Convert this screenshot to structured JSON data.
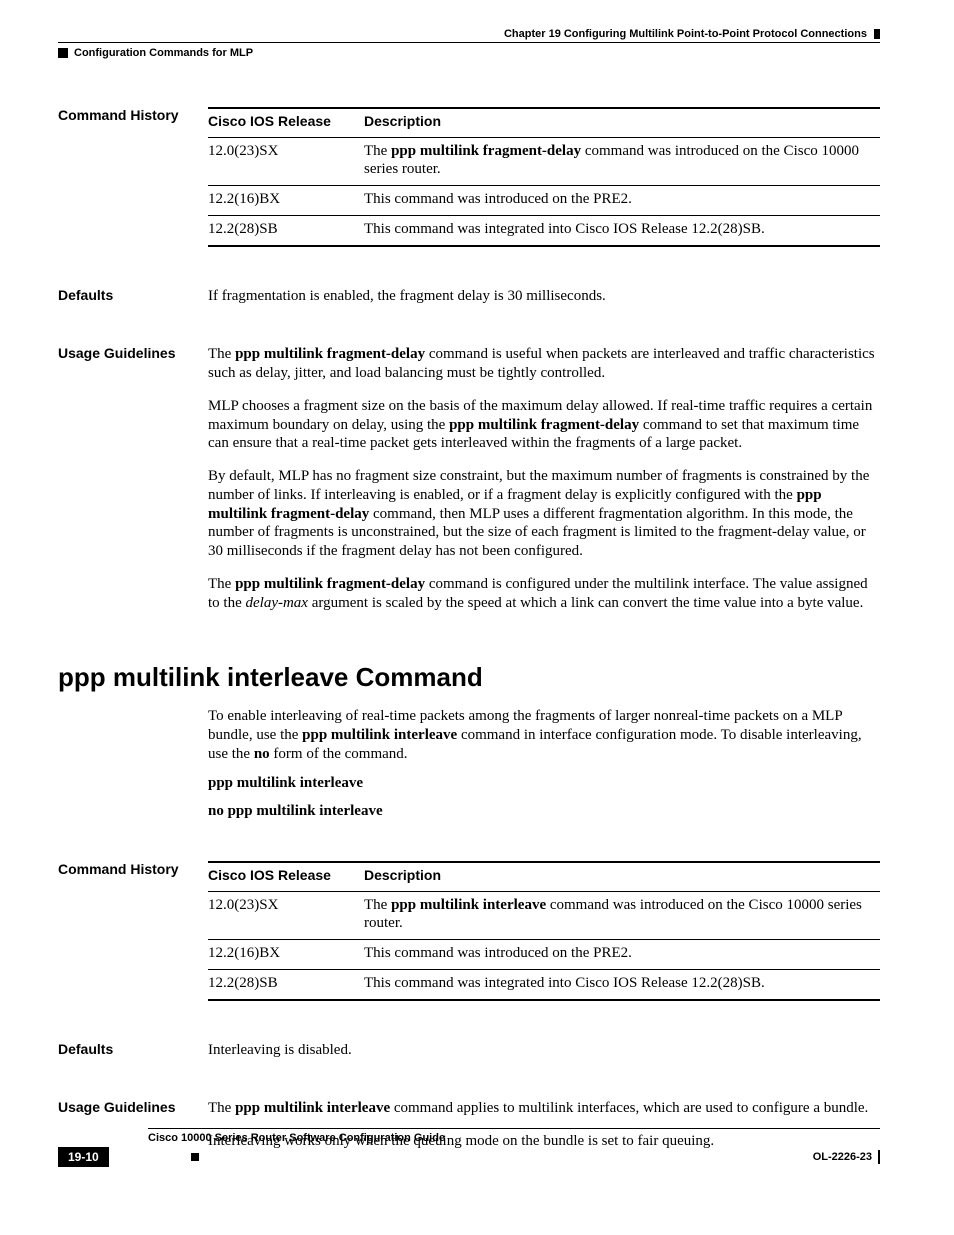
{
  "header": {
    "chapter": "Chapter 19      Configuring Multilink Point-to-Point Protocol Connections",
    "section": "Configuration Commands for MLP"
  },
  "history1": {
    "label": "Command History",
    "cols": {
      "c1": "Cisco IOS Release",
      "c2": "Description"
    },
    "rows": [
      {
        "rel": "12.0(23)SX",
        "desc_pre": "The ",
        "desc_bold": "ppp multilink fragment-delay",
        "desc_post": " command was introduced on the Cisco 10000 series router."
      },
      {
        "rel": "12.2(16)BX",
        "desc_pre": "This command was introduced on the PRE2.",
        "desc_bold": "",
        "desc_post": ""
      },
      {
        "rel": "12.2(28)SB",
        "desc_pre": "This command was integrated into Cisco IOS Release 12.2(28)SB.",
        "desc_bold": "",
        "desc_post": ""
      }
    ]
  },
  "defaults1": {
    "label": "Defaults",
    "text": "If fragmentation is enabled, the fragment delay is 30 milliseconds."
  },
  "usage1": {
    "label": "Usage Guidelines",
    "p1": {
      "a": "The ",
      "b": "ppp multilink fragment-delay",
      "c": " command is useful when packets are interleaved and traffic characteristics such as delay, jitter, and load balancing must be tightly controlled."
    },
    "p2": {
      "a": "MLP chooses a fragment size on the basis of the maximum delay allowed. If real-time traffic requires a certain maximum boundary on delay, using the ",
      "b": "ppp multilink fragment-delay",
      "c": " command to set that maximum time can ensure that a real-time packet gets interleaved within the fragments of a large packet."
    },
    "p3": {
      "a": "By default, MLP has no fragment size constraint, but the maximum number of fragments is constrained by the number of links. If interleaving is enabled, or if a fragment delay is explicitly configured with the ",
      "b": "ppp multilink fragment-delay",
      "c": " command, then MLP uses a different fragmentation algorithm. In this mode, the number of fragments is unconstrained, but the size of each fragment is limited to the fragment-delay value, or 30 milliseconds if the fragment delay has not been configured."
    },
    "p4": {
      "a": "The ",
      "b": "ppp multilink fragment-delay",
      "c": " command is configured under the multilink interface. The value assigned to the ",
      "d": "delay-max",
      "e": " argument is scaled by the speed at which a link can convert the time value into a byte value."
    }
  },
  "cmd2": {
    "title": "ppp multilink interleave Command",
    "intro": {
      "a": "To enable interleaving of real-time packets among the fragments of larger nonreal-time packets on a MLP bundle, use the ",
      "b": "ppp multilink interleave",
      "c": " command in interface configuration mode. To disable interleaving, use the ",
      "d": "no",
      "e": " form of the command."
    },
    "syntax1": "ppp multilink interleave",
    "syntax2": "no ppp multilink interleave"
  },
  "history2": {
    "label": "Command History",
    "cols": {
      "c1": "Cisco IOS Release",
      "c2": "Description"
    },
    "rows": [
      {
        "rel": "12.0(23)SX",
        "desc_pre": "The ",
        "desc_bold": "ppp multilink interleave",
        "desc_post": " command was introduced on the Cisco 10000 series router."
      },
      {
        "rel": "12.2(16)BX",
        "desc_pre": "This command was introduced on the PRE2.",
        "desc_bold": "",
        "desc_post": ""
      },
      {
        "rel": "12.2(28)SB",
        "desc_pre": "This command was integrated into Cisco IOS Release 12.2(28)SB.",
        "desc_bold": "",
        "desc_post": ""
      }
    ]
  },
  "defaults2": {
    "label": "Defaults",
    "text": "Interleaving is disabled."
  },
  "usage2": {
    "label": "Usage Guidelines",
    "p1": {
      "a": "The ",
      "b": "ppp multilink interleave",
      "c": " command applies to multilink interfaces, which are used to configure a bundle."
    },
    "p2": "Interleaving works only when the queuing mode on the bundle is set to fair queuing."
  },
  "footer": {
    "booktitle": "Cisco 10000 Series Router Software Configuration Guide",
    "pagenum": "19-10",
    "docid": "OL-2226-23"
  }
}
